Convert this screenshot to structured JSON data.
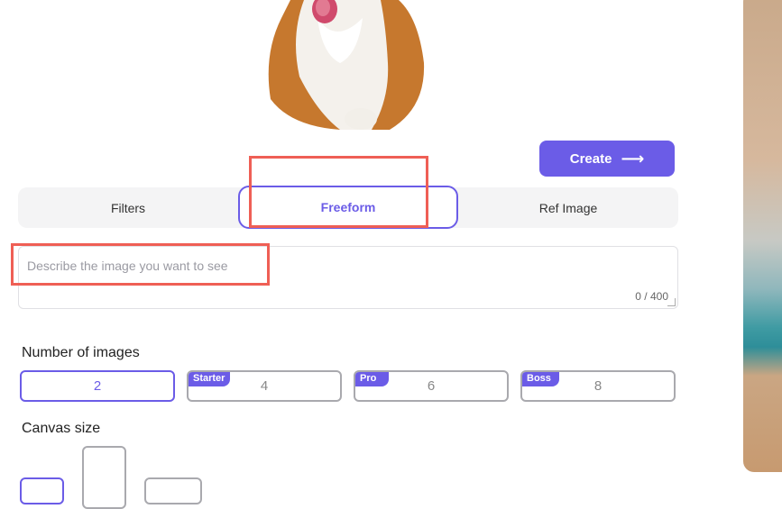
{
  "toolbar": {
    "create_label": "Create",
    "create_icon": "arrow-right-icon"
  },
  "tabs": [
    {
      "label": "Filters",
      "active": false
    },
    {
      "label": "Freeform",
      "active": true
    },
    {
      "label": "Ref Image",
      "active": false
    }
  ],
  "prompt": {
    "placeholder": "Describe the image you want to see",
    "counter": "0 / 400"
  },
  "num_images": {
    "label": "Number of images",
    "options": [
      {
        "value": "2",
        "badge": "",
        "selected": true
      },
      {
        "value": "4",
        "badge": "Starter",
        "selected": false
      },
      {
        "value": "6",
        "badge": "Pro",
        "selected": false
      },
      {
        "value": "8",
        "badge": "Boss",
        "selected": false
      }
    ]
  },
  "canvas_size": {
    "label": "Canvas size",
    "options": [
      "square",
      "portrait",
      "landscape"
    ],
    "selected": "square"
  },
  "colors": {
    "accent": "#6b5ce7",
    "highlight": "#ef5f55"
  }
}
